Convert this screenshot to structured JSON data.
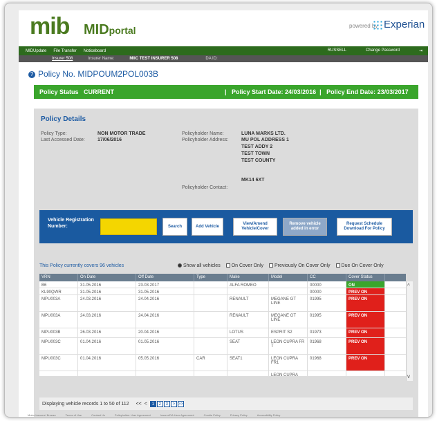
{
  "header": {
    "logo_mib": "mib",
    "logo_mid": "MID",
    "logo_portal": "portal",
    "powered_by": "powered by",
    "experian": "Experian"
  },
  "topnav": {
    "items": [
      "MIDUpdate",
      "File Transfer",
      "Noticeboard"
    ],
    "user": "RUSSELL",
    "change_password": "Change Password"
  },
  "subnav": {
    "insurer_link": "Insurer 508",
    "insurer_name_label": "Insurer Name:",
    "insurer_name": "MIIC TEST INSURER 508",
    "da_id_label": "DA ID:"
  },
  "policy": {
    "title": "Policy No. MIDPOUM2POL003B",
    "status": "Policy Status   CURRENT",
    "start": "|   Policy Start Date: 24/03/2016  |   Policy End Date: 23/03/2017"
  },
  "details": {
    "heading": "Policy Details",
    "policy_type_label": "Policy Type:",
    "policy_type": "NON MOTOR TRADE",
    "last_accessed_label": "Last Accessed Date:",
    "last_accessed": "17/06/2016",
    "holder_name_label": "Policyholder Name:",
    "holder_name": "LUNA MARKS LTD.",
    "holder_address_label": "Policyholder Address:",
    "address_lines": [
      "MU POL ADDRESS 1",
      "TEST ADDY 2",
      "TEST TOWN",
      "TEST COUNTY",
      "",
      "MK14 6XT"
    ],
    "holder_contact_label": "Policyholder Contact:"
  },
  "search": {
    "label": "Vehicle Registration Number:",
    "search_button": "Search",
    "add_button": "Add Vehicle",
    "view_button": "View/Amend Vehicle/Cover",
    "remove_button": "Remove vehicle added in error",
    "schedule_button": "Request Schedule Download For Policy"
  },
  "filters": {
    "coverage_text": "This Policy currently covers 96 vehicles",
    "show_all": "Show all vehicles",
    "on_cover": "On Cover Only",
    "prev_cover": "Previously On Cover Only",
    "due_cover": "Due On Cover Only"
  },
  "table": {
    "columns": [
      "VRN",
      "On Date",
      "Off Date",
      "Type",
      "Make",
      "Model",
      "CC",
      "Cover Status"
    ],
    "rows": [
      [
        "B6",
        "31.05.2016",
        "23.03.2017",
        "",
        "ALFA ROMEO",
        "",
        "00000",
        "ON"
      ],
      [
        "KL90QWR",
        "31.05.2016",
        "31.05.2016",
        "",
        "",
        "",
        "00000",
        "PREV ON"
      ],
      [
        "MPU003A",
        "24.03.2016",
        "24.04.2016",
        "",
        "RENAULT",
        "MEGANE GT LINE",
        "01995",
        "PREV ON"
      ],
      [
        "MPU003A",
        "24.03.2016",
        "24.04.2016",
        "",
        "RENAULT",
        "MEGANE GT LINE",
        "01995",
        "PREV ON"
      ],
      [
        "MPU003B",
        "26.03.2016",
        "20.04.2016",
        "",
        "LOTUS",
        "ESPRIT S2",
        "01973",
        "PREV ON"
      ],
      [
        "MPU003C",
        "01.04.2016",
        "01.05.2016",
        "",
        "SEAT",
        "LEON CUPRA FR T",
        "01968",
        "PREV ON"
      ],
      [
        "MPU003C",
        "01.04.2016",
        "05.05.2016",
        "CAR",
        "SEAT1",
        "LEON CUPRA FR1",
        "01968",
        "PREV ON"
      ],
      [
        "",
        "",
        "",
        "",
        "",
        "LEON CUPRA",
        "",
        ""
      ]
    ],
    "status_colors": {
      "ON": "#3aa52c",
      "PREV ON": "#e0201b"
    }
  },
  "pager": {
    "text": "Displaying vehicle records 1 to 50 of 112",
    "first": "<<",
    "prev": "<",
    "pages": [
      "1",
      "2",
      "3"
    ],
    "next": ">",
    "last": ">>"
  },
  "footer": {
    "links": [
      "Motor Insurers' Bureau",
      "Terms of Use",
      "Contact Us",
      "Policyholder User Agreement",
      "Insurer/DA User Agreement",
      "Cookie Policy",
      "Privacy Policy",
      "Accessibility Policy"
    ]
  }
}
